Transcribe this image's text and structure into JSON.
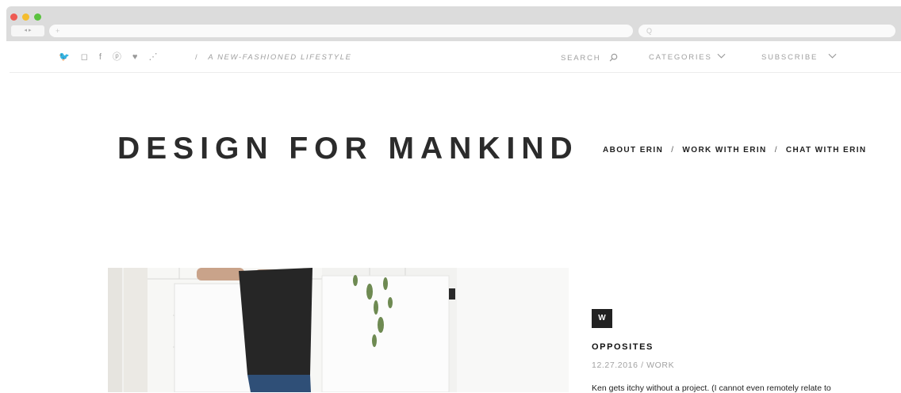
{
  "browser": {
    "nav_buttons": "◂ ▸",
    "url_placeholder": "+",
    "search_placeholder": "Q"
  },
  "topbar": {
    "social_icons": [
      "twitter-icon",
      "instagram-icon",
      "facebook-icon",
      "pinterest-icon",
      "heart-icon",
      "rss-icon"
    ],
    "social_glyphs": [
      "🐦",
      "◻",
      "f",
      "ⓟ",
      "♥",
      "⋰"
    ],
    "tagline_separator": "/",
    "tagline": "A NEW-FASHIONED LIFESTYLE",
    "search_label": "SEARCH",
    "categories_label": "CATEGORIES",
    "subscribe_label": "SUBSCRIBE"
  },
  "header": {
    "site_title": "DESIGN FOR MANKIND",
    "nav": [
      "ABOUT ERIN",
      "WORK WITH ERIN",
      "CHAT WITH ERIN"
    ],
    "nav_separator": "/"
  },
  "post": {
    "category_badge": "W",
    "title": "OPPOSITES",
    "meta": "12.27.2016 / WORK",
    "excerpt": "Ken gets itchy without a project. (I cannot even remotely relate to"
  },
  "colors": {
    "accent_text": "#1f1f1f",
    "muted_text": "#a0a0a0",
    "chrome_bg": "#dcdcdc"
  }
}
